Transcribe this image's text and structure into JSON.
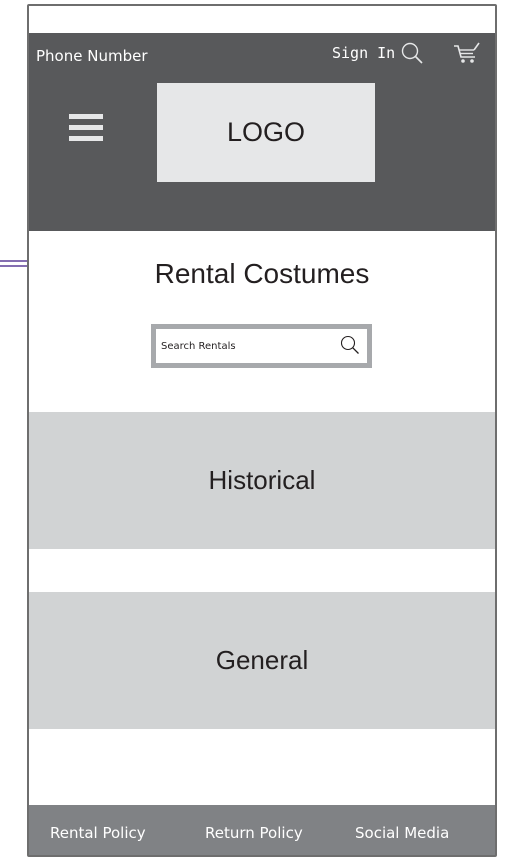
{
  "header": {
    "phone_label": "Phone Number",
    "sign_in_label": "Sign In",
    "search_icon": "search-icon",
    "cart_icon": "cart-icon",
    "menu_icon": "hamburger-menu-icon",
    "logo_text": "LOGO"
  },
  "main": {
    "title": "Rental Costumes",
    "search": {
      "placeholder": "Search Rentals",
      "value": "",
      "icon": "search-icon"
    },
    "categories": [
      {
        "label": "Historical"
      },
      {
        "label": "General"
      }
    ]
  },
  "footer": {
    "links": [
      {
        "label": "Rental Policy"
      },
      {
        "label": "Return Policy"
      },
      {
        "label": "Social Media"
      }
    ]
  },
  "colors": {
    "header_bg": "#58595b",
    "logo_bg": "#e6e7e8",
    "category_bg": "#d1d3d4",
    "search_border": "#a7a9ac",
    "footer_bg": "#808285",
    "annotation_arrow": "#5b3f97"
  }
}
